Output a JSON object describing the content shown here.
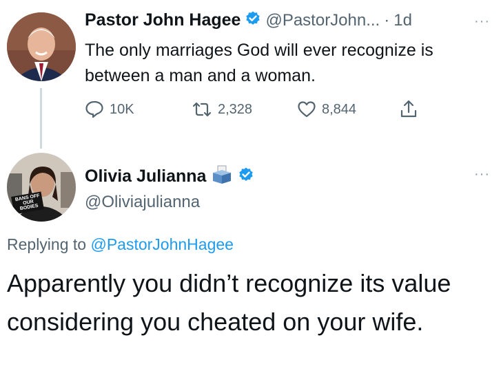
{
  "tweet": {
    "author_name": "Pastor John Hagee",
    "handle": "@PastorJohn...",
    "separator": "·",
    "time": "1d",
    "more": "···",
    "text": "The only marriages God will ever recognize is between a man and a woman.",
    "actions": {
      "replies": "10K",
      "retweets": "2,328",
      "likes": "8,844"
    }
  },
  "reply": {
    "author_name": "Olivia Julianna",
    "handle": "@Oliviajulianna",
    "more": "···",
    "avatar_sign": "BANS OFF OUR BODIES",
    "replying_label": "Replying to",
    "replying_handle": "@PastorJohnHagee",
    "text": "Apparently you didn’t recognize its value considering you cheated on your wife."
  },
  "colors": {
    "verified_blue": "#1d9bf0",
    "text_primary": "#0f1419",
    "text_secondary": "#536471",
    "thread_line": "#cfd9de"
  },
  "icons": [
    "verified-badge-icon",
    "reply-icon",
    "retweet-icon",
    "like-icon",
    "share-icon",
    "ballot-box-icon",
    "more-icon"
  ]
}
